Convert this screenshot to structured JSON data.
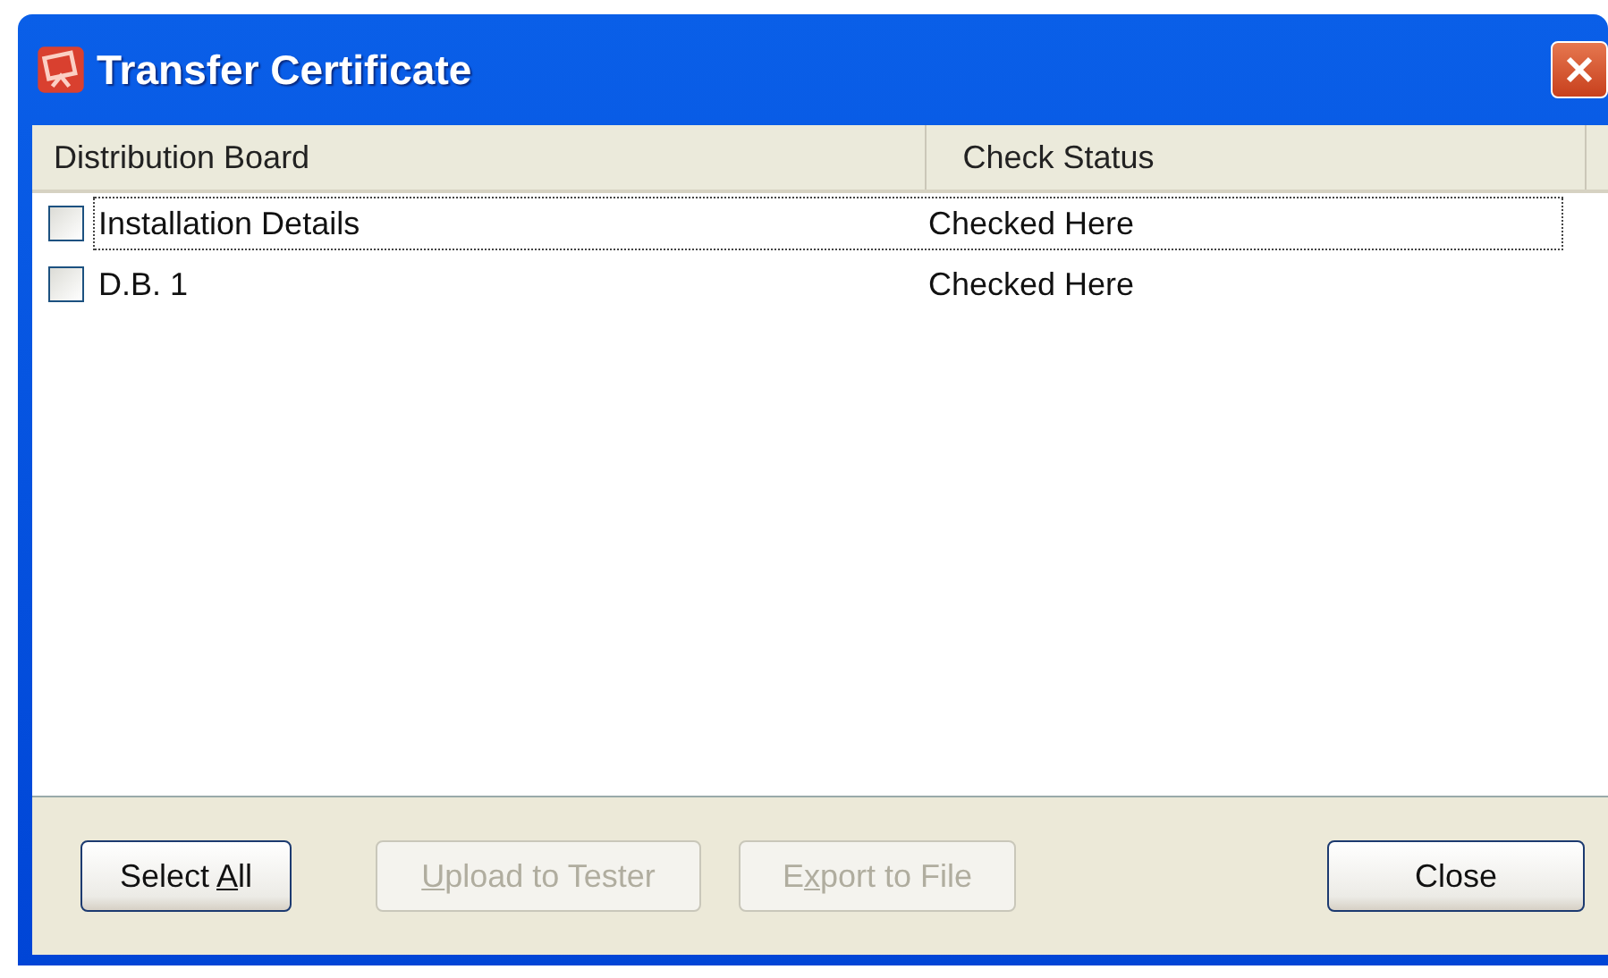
{
  "window": {
    "title": "Transfer Certificate"
  },
  "table": {
    "columns": [
      "Distribution Board",
      "Check Status"
    ],
    "rows": [
      {
        "name": "Installation Details",
        "status": "Checked Here",
        "checked": false,
        "focused": true
      },
      {
        "name": "D.B. 1",
        "status": "Checked Here",
        "checked": false,
        "focused": false
      }
    ]
  },
  "buttons": [
    {
      "before": "Select ",
      "access_key": "A",
      "after": "ll",
      "disabled": false
    },
    {
      "access_key": "U",
      "after": "pload to Tester",
      "disabled": true
    },
    {
      "before": "E",
      "access_key": "x",
      "after": "port to File",
      "disabled": true
    },
    {
      "before": "Close",
      "disabled": false
    }
  ]
}
